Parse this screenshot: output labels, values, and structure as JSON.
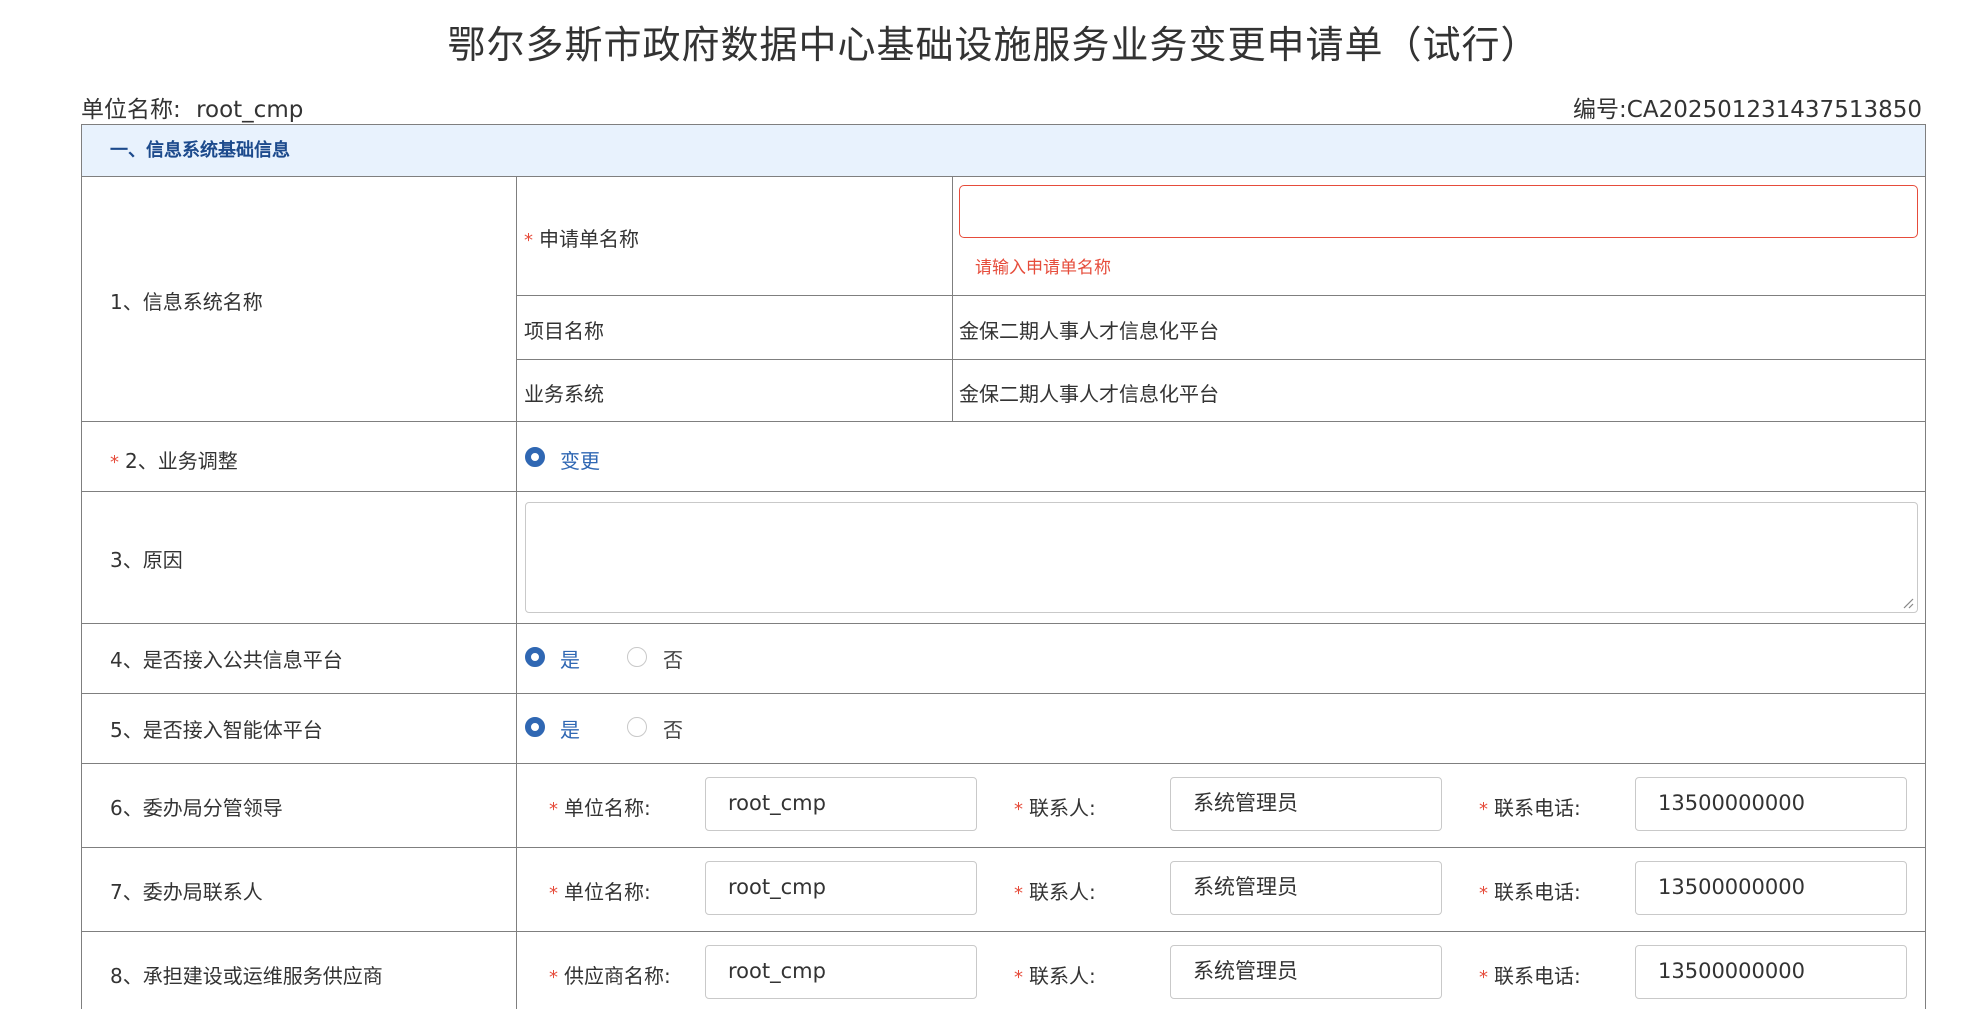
{
  "page": {
    "title": "鄂尔多斯市政府数据中心基础设施服务业务变更申请单（试行）",
    "unit_label": "单位名称:",
    "unit_value": "root_cmp",
    "number_label": "编号:",
    "number_value": "CA202501231437513850"
  },
  "section": {
    "title": "一、信息系统基础信息"
  },
  "required_mark": "*",
  "row1": {
    "label": "1、信息系统名称",
    "application_name": {
      "label": "申请单名称",
      "value": "",
      "error": "请输入申请单名称"
    },
    "project": {
      "label": "项目名称",
      "value": "金保二期人事人才信息化平台"
    },
    "business_system": {
      "label": "业务系统",
      "value": "金保二期人事人才信息化平台"
    }
  },
  "row2": {
    "label": "2、业务调整",
    "option": "变更",
    "selected": true
  },
  "row3": {
    "label": "3、原因",
    "value": ""
  },
  "row4": {
    "label": "4、是否接入公共信息平台",
    "options": [
      "是",
      "否"
    ],
    "selected": "是"
  },
  "row5": {
    "label": "5、是否接入智能体平台",
    "options": [
      "是",
      "否"
    ],
    "selected": "是"
  },
  "row6": {
    "label": "6、委办局分管领导",
    "org_label": "单位名称:",
    "org_value": "root_cmp",
    "contact_label": "联系人:",
    "contact_value": "系统管理员",
    "phone_label": "联系电话:",
    "phone_value": "13500000000"
  },
  "row7": {
    "label": "7、委办局联系人",
    "org_label": "单位名称:",
    "org_value": "root_cmp",
    "contact_label": "联系人:",
    "contact_value": "系统管理员",
    "phone_label": "联系电话:",
    "phone_value": "13500000000"
  },
  "row8": {
    "label": "8、承担建设或运维服务供应商",
    "org_label": "供应商名称:",
    "org_value": "root_cmp",
    "contact_label": "联系人:",
    "contact_value": "系统管理员",
    "phone_label": "联系电话:",
    "phone_value": "13500000000"
  },
  "colors": {
    "accent": "#2f67b3",
    "error": "#e64c3b",
    "section_bg": "#e8f2fd",
    "section_text": "#1c4a8c"
  }
}
